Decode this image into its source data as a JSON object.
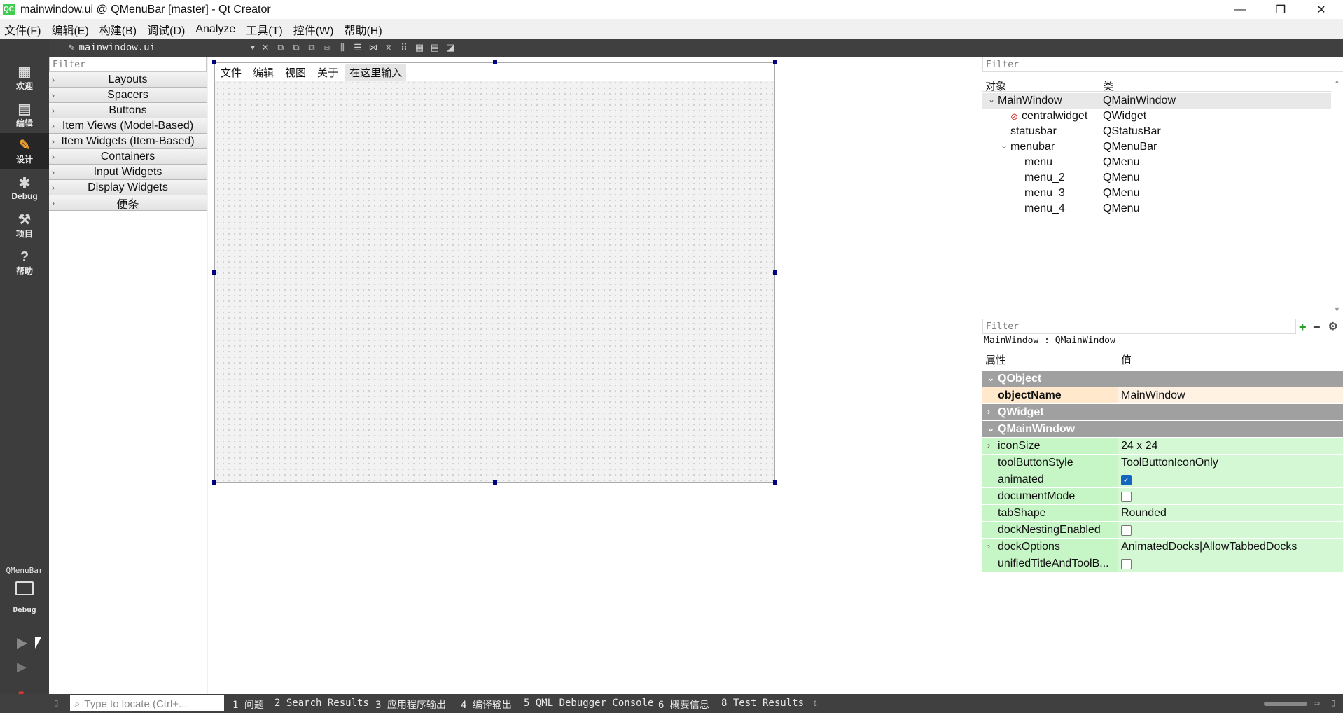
{
  "window": {
    "title": "mainwindow.ui @ QMenuBar [master] - Qt Creator",
    "app_icon": "QC",
    "minimize": "—",
    "maximize": "❐",
    "close": "✕"
  },
  "menubar": [
    "文件(F)",
    "编辑(E)",
    "构建(B)",
    "调试(D)",
    "Analyze",
    "工具(T)",
    "控件(W)",
    "帮助(H)"
  ],
  "modes": [
    {
      "label": "欢迎",
      "icon": "grid-icon"
    },
    {
      "label": "编辑",
      "icon": "edit-doc-icon"
    },
    {
      "label": "设计",
      "icon": "pencil-icon"
    },
    {
      "label": "Debug",
      "icon": "bug-icon"
    },
    {
      "label": "项目",
      "icon": "wrench-icon"
    },
    {
      "label": "帮助",
      "icon": "help-icon"
    }
  ],
  "kit": {
    "project": "QMenuBar",
    "config": "Debug"
  },
  "editor": {
    "file": "mainwindow.ui"
  },
  "widgetbox": {
    "filter_placeholder": "Filter",
    "categories": [
      "Layouts",
      "Spacers",
      "Buttons",
      "Item Views (Model-Based)",
      "Item Widgets (Item-Based)",
      "Containers",
      "Input Widgets",
      "Display Widgets",
      "便条"
    ]
  },
  "form": {
    "menus": [
      "文件",
      "编辑",
      "视图",
      "关于"
    ],
    "type_here": "在这里输入"
  },
  "object_inspector": {
    "filter_placeholder": "Filter",
    "col_object": "对象",
    "col_class": "类",
    "rows": [
      {
        "name": "MainWindow",
        "class": "QMainWindow",
        "arrow": "⌄"
      },
      {
        "name": "centralwidget",
        "class": "QWidget"
      },
      {
        "name": "statusbar",
        "class": "QStatusBar"
      },
      {
        "name": "menubar",
        "class": "QMenuBar",
        "arrow": "⌄"
      },
      {
        "name": "menu",
        "class": "QMenu"
      },
      {
        "name": "menu_2",
        "class": "QMenu"
      },
      {
        "name": "menu_3",
        "class": "QMenu"
      },
      {
        "name": "menu_4",
        "class": "QMenu"
      }
    ]
  },
  "property_editor": {
    "filter_placeholder": "Filter",
    "context": "MainWindow : QMainWindow",
    "col_property": "属性",
    "col_value": "值",
    "groups": {
      "qobject": "QObject",
      "qwidget": "QWidget",
      "qmainwindow": "QMainWindow"
    },
    "object_name": {
      "key": "objectName",
      "value": "MainWindow"
    },
    "props": [
      {
        "key": "iconSize",
        "value": "24 x 24"
      },
      {
        "key": "toolButtonStyle",
        "value": "ToolButtonIconOnly"
      },
      {
        "key": "animated",
        "checked": true
      },
      {
        "key": "documentMode",
        "checked": false
      },
      {
        "key": "tabShape",
        "value": "Rounded"
      },
      {
        "key": "dockNestingEnabled",
        "checked": false
      },
      {
        "key": "dockOptions",
        "value": "AnimatedDocks|AllowTabbedDocks"
      },
      {
        "key": "unifiedTitleAndToolB...",
        "checked": false
      }
    ]
  },
  "statusbar": {
    "locator_placeholder": "Type to locate (Ctrl+...",
    "panes": [
      "1 问题",
      "2 Search Results",
      "3 应用程序输出",
      "4 编译输出",
      "5 QML Debugger Console",
      "6 概要信息",
      "8 Test Results"
    ]
  }
}
